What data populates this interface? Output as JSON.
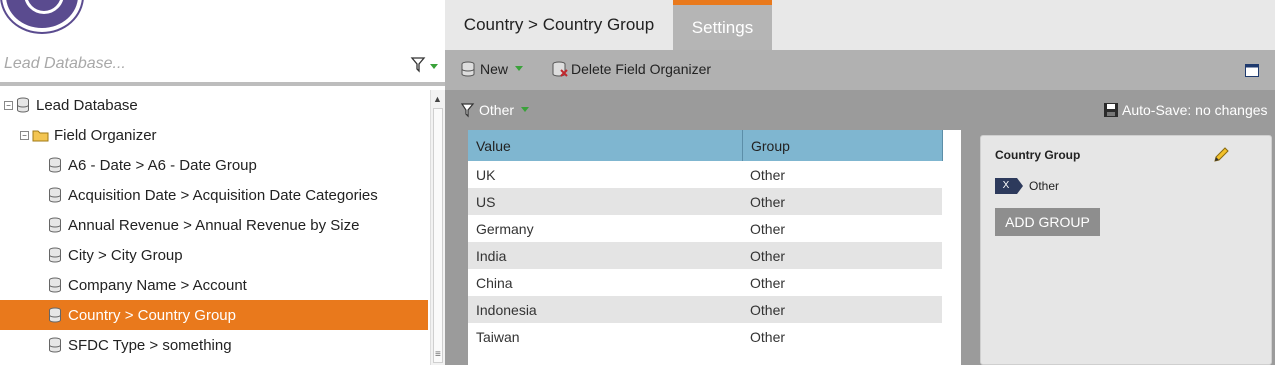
{
  "search": {
    "placeholder": "Lead Database..."
  },
  "tree": {
    "items": [
      {
        "label": "Lead Database",
        "level": 0,
        "icon": "database-icon",
        "expander": "−",
        "selected": false
      },
      {
        "label": "Field Organizer",
        "level": 1,
        "icon": "folder-icon",
        "expander": "−",
        "selected": false
      },
      {
        "label": "A6 - Date > A6 - Date Group",
        "level": 2,
        "icon": "field-organizer-icon",
        "selected": false
      },
      {
        "label": "Acquisition Date > Acquisition Date Categories",
        "level": 2,
        "icon": "field-organizer-icon",
        "selected": false
      },
      {
        "label": "Annual Revenue > Annual Revenue by Size",
        "level": 2,
        "icon": "field-organizer-icon",
        "selected": false
      },
      {
        "label": "City > City Group",
        "level": 2,
        "icon": "field-organizer-icon",
        "selected": false
      },
      {
        "label": "Company Name > Account",
        "level": 2,
        "icon": "field-organizer-icon",
        "selected": false
      },
      {
        "label": "Country > Country Group",
        "level": 2,
        "icon": "field-organizer-icon",
        "selected": true
      },
      {
        "label": "SFDC Type > something",
        "level": 2,
        "icon": "field-organizer-icon",
        "selected": false
      }
    ]
  },
  "tabs": {
    "main": "Country > Country Group",
    "settings": "Settings"
  },
  "toolbar": {
    "new_label": "New",
    "delete_label": "Delete Field Organizer"
  },
  "subbar": {
    "filter_label": "Other",
    "autosave_label": "Auto-Save: no changes"
  },
  "grid": {
    "columns": [
      "Value",
      "Group"
    ],
    "rows": [
      {
        "value": "UK",
        "group": "Other"
      },
      {
        "value": "US",
        "group": "Other"
      },
      {
        "value": "Germany",
        "group": "Other"
      },
      {
        "value": "India",
        "group": "Other"
      },
      {
        "value": "China",
        "group": "Other"
      },
      {
        "value": "Indonesia",
        "group": "Other"
      },
      {
        "value": "Taiwan",
        "group": "Other"
      }
    ]
  },
  "group_panel": {
    "title": "Country Group",
    "chip_remove": "X",
    "chip_label": "Other",
    "add_group_label": "ADD GROUP"
  },
  "colors": {
    "accent": "#e9791c",
    "grid_header": "#7fb6d0",
    "brand": "#5a4b8f"
  }
}
